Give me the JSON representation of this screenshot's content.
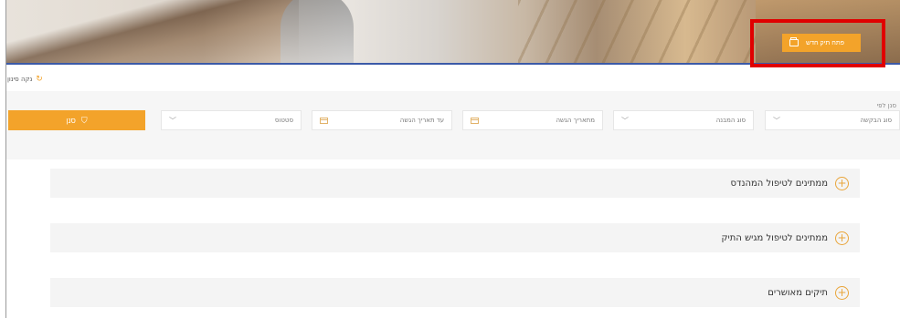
{
  "header": {
    "open_file_button": "פתח תיק חדש"
  },
  "filters": {
    "clear_filter": "נקה סינון",
    "sort_by": "סנן לפי",
    "request_type": "סוג הבקשה",
    "structure_type": "סוג המבנה",
    "submission_date_from": "מתאריך הגשה",
    "submission_date_to": "עד תאריך הגשה",
    "status": "סטטוס",
    "filter_button": "סנן"
  },
  "sections": [
    {
      "label": "ממתינים לטיפול המהנדס"
    },
    {
      "label": "ממתינים לטיפול מגיש התיק"
    },
    {
      "label": "תיקים מאושרים"
    }
  ],
  "colors": {
    "accent": "#f3a32a",
    "highlight": "#e00000"
  }
}
